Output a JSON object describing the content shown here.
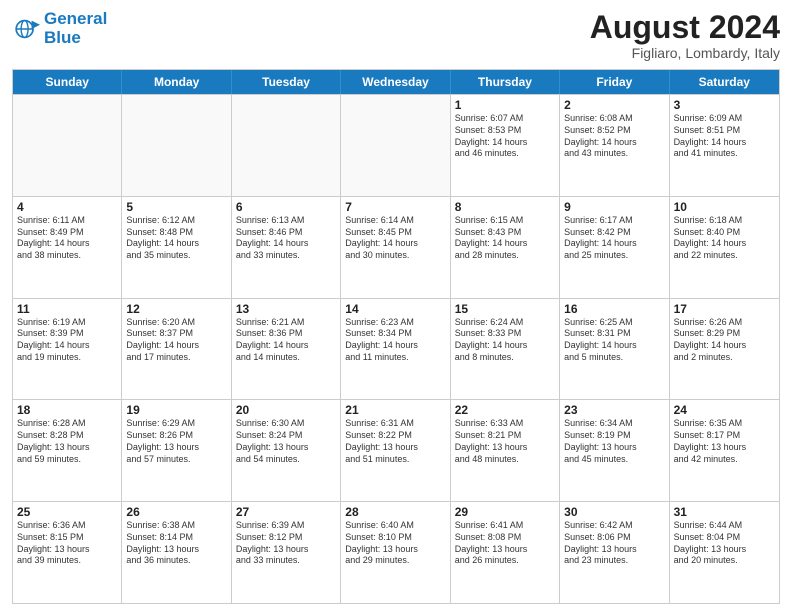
{
  "logo": {
    "line1": "General",
    "line2": "Blue"
  },
  "title": "August 2024",
  "location": "Figliaro, Lombardy, Italy",
  "days_of_week": [
    "Sunday",
    "Monday",
    "Tuesday",
    "Wednesday",
    "Thursday",
    "Friday",
    "Saturday"
  ],
  "weeks": [
    [
      {
        "day": "",
        "info": "",
        "empty": true
      },
      {
        "day": "",
        "info": "",
        "empty": true
      },
      {
        "day": "",
        "info": "",
        "empty": true
      },
      {
        "day": "",
        "info": "",
        "empty": true
      },
      {
        "day": "1",
        "info": "Sunrise: 6:07 AM\nSunset: 8:53 PM\nDaylight: 14 hours\nand 46 minutes."
      },
      {
        "day": "2",
        "info": "Sunrise: 6:08 AM\nSunset: 8:52 PM\nDaylight: 14 hours\nand 43 minutes."
      },
      {
        "day": "3",
        "info": "Sunrise: 6:09 AM\nSunset: 8:51 PM\nDaylight: 14 hours\nand 41 minutes."
      }
    ],
    [
      {
        "day": "4",
        "info": "Sunrise: 6:11 AM\nSunset: 8:49 PM\nDaylight: 14 hours\nand 38 minutes."
      },
      {
        "day": "5",
        "info": "Sunrise: 6:12 AM\nSunset: 8:48 PM\nDaylight: 14 hours\nand 35 minutes."
      },
      {
        "day": "6",
        "info": "Sunrise: 6:13 AM\nSunset: 8:46 PM\nDaylight: 14 hours\nand 33 minutes."
      },
      {
        "day": "7",
        "info": "Sunrise: 6:14 AM\nSunset: 8:45 PM\nDaylight: 14 hours\nand 30 minutes."
      },
      {
        "day": "8",
        "info": "Sunrise: 6:15 AM\nSunset: 8:43 PM\nDaylight: 14 hours\nand 28 minutes."
      },
      {
        "day": "9",
        "info": "Sunrise: 6:17 AM\nSunset: 8:42 PM\nDaylight: 14 hours\nand 25 minutes."
      },
      {
        "day": "10",
        "info": "Sunrise: 6:18 AM\nSunset: 8:40 PM\nDaylight: 14 hours\nand 22 minutes."
      }
    ],
    [
      {
        "day": "11",
        "info": "Sunrise: 6:19 AM\nSunset: 8:39 PM\nDaylight: 14 hours\nand 19 minutes."
      },
      {
        "day": "12",
        "info": "Sunrise: 6:20 AM\nSunset: 8:37 PM\nDaylight: 14 hours\nand 17 minutes."
      },
      {
        "day": "13",
        "info": "Sunrise: 6:21 AM\nSunset: 8:36 PM\nDaylight: 14 hours\nand 14 minutes."
      },
      {
        "day": "14",
        "info": "Sunrise: 6:23 AM\nSunset: 8:34 PM\nDaylight: 14 hours\nand 11 minutes."
      },
      {
        "day": "15",
        "info": "Sunrise: 6:24 AM\nSunset: 8:33 PM\nDaylight: 14 hours\nand 8 minutes."
      },
      {
        "day": "16",
        "info": "Sunrise: 6:25 AM\nSunset: 8:31 PM\nDaylight: 14 hours\nand 5 minutes."
      },
      {
        "day": "17",
        "info": "Sunrise: 6:26 AM\nSunset: 8:29 PM\nDaylight: 14 hours\nand 2 minutes."
      }
    ],
    [
      {
        "day": "18",
        "info": "Sunrise: 6:28 AM\nSunset: 8:28 PM\nDaylight: 13 hours\nand 59 minutes."
      },
      {
        "day": "19",
        "info": "Sunrise: 6:29 AM\nSunset: 8:26 PM\nDaylight: 13 hours\nand 57 minutes."
      },
      {
        "day": "20",
        "info": "Sunrise: 6:30 AM\nSunset: 8:24 PM\nDaylight: 13 hours\nand 54 minutes."
      },
      {
        "day": "21",
        "info": "Sunrise: 6:31 AM\nSunset: 8:22 PM\nDaylight: 13 hours\nand 51 minutes."
      },
      {
        "day": "22",
        "info": "Sunrise: 6:33 AM\nSunset: 8:21 PM\nDaylight: 13 hours\nand 48 minutes."
      },
      {
        "day": "23",
        "info": "Sunrise: 6:34 AM\nSunset: 8:19 PM\nDaylight: 13 hours\nand 45 minutes."
      },
      {
        "day": "24",
        "info": "Sunrise: 6:35 AM\nSunset: 8:17 PM\nDaylight: 13 hours\nand 42 minutes."
      }
    ],
    [
      {
        "day": "25",
        "info": "Sunrise: 6:36 AM\nSunset: 8:15 PM\nDaylight: 13 hours\nand 39 minutes."
      },
      {
        "day": "26",
        "info": "Sunrise: 6:38 AM\nSunset: 8:14 PM\nDaylight: 13 hours\nand 36 minutes."
      },
      {
        "day": "27",
        "info": "Sunrise: 6:39 AM\nSunset: 8:12 PM\nDaylight: 13 hours\nand 33 minutes."
      },
      {
        "day": "28",
        "info": "Sunrise: 6:40 AM\nSunset: 8:10 PM\nDaylight: 13 hours\nand 29 minutes."
      },
      {
        "day": "29",
        "info": "Sunrise: 6:41 AM\nSunset: 8:08 PM\nDaylight: 13 hours\nand 26 minutes."
      },
      {
        "day": "30",
        "info": "Sunrise: 6:42 AM\nSunset: 8:06 PM\nDaylight: 13 hours\nand 23 minutes."
      },
      {
        "day": "31",
        "info": "Sunrise: 6:44 AM\nSunset: 8:04 PM\nDaylight: 13 hours\nand 20 minutes."
      }
    ]
  ]
}
